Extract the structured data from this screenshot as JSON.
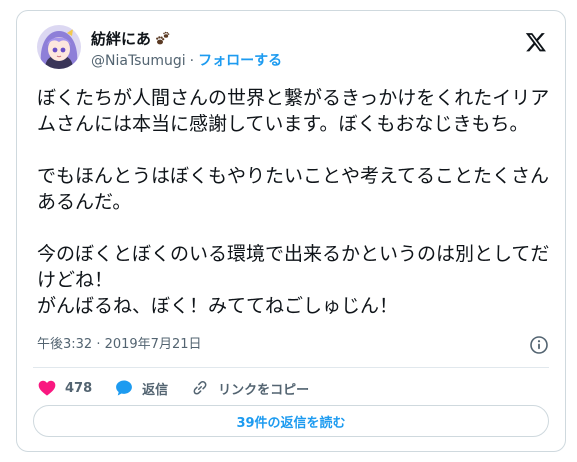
{
  "author": {
    "display_name": "紡絆にあ",
    "handle": "@NiaTsumugi",
    "separator": "·",
    "follow_label": "フォローする"
  },
  "tweet": {
    "paragraphs": [
      "ぼくたちが人間さんの世界と繋がるきっかけをくれたイリアムさんには本当に感謝しています。ぼくもおなじきもち。",
      "でもほんとうはぼくもやりたいことや考えてることたくさんあるんだ。",
      "今のぼくとぼくのいる環境で出来るかというのは別としてだけどね！",
      "がんばるね、ぼく！みててねごしゅじん！"
    ],
    "timestamp": "午後3:32 · 2019年7月21日"
  },
  "actions": {
    "like_count": "478",
    "reply_label": "返信",
    "copy_link_label": "リンクをコピー"
  },
  "read_replies_label": "39件の返信を読む",
  "icons": {
    "brand": "x-logo-icon",
    "emoji": "paw-prints-icon",
    "like": "heart-icon",
    "reply": "speech-bubble-icon",
    "copy": "link-icon",
    "info": "info-icon"
  },
  "colors": {
    "accent": "#1d9bf0",
    "like": "#f91880",
    "text": "#0f1419",
    "muted": "#536471",
    "border": "#cfd9de"
  }
}
